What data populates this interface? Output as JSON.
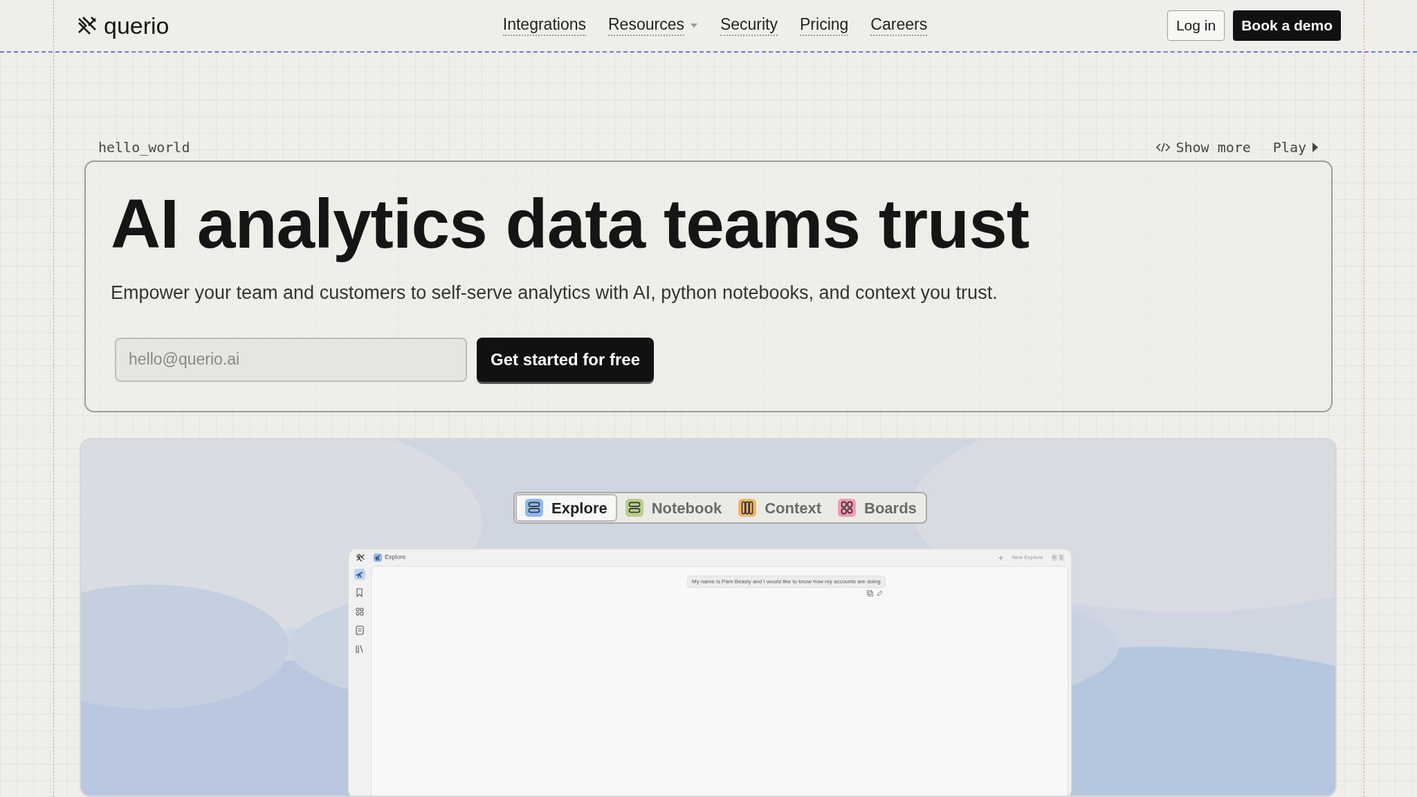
{
  "brand": {
    "name": "querio"
  },
  "nav": {
    "links": [
      {
        "label": "Integrations",
        "dropdown": false
      },
      {
        "label": "Resources",
        "dropdown": true
      },
      {
        "label": "Security",
        "dropdown": false
      },
      {
        "label": "Pricing",
        "dropdown": false
      },
      {
        "label": "Careers",
        "dropdown": false
      }
    ],
    "login": "Log in",
    "demo": "Book a demo"
  },
  "code_bar": {
    "filename": "hello_world",
    "show_more": "Show more",
    "play": "Play"
  },
  "hero": {
    "title": "AI analytics data teams trust",
    "subtitle": "Empower your team and customers to self-serve analytics with AI, python notebooks, and context you trust.",
    "email": {
      "placeholder": "hello@querio.ai"
    },
    "cta": "Get started for free"
  },
  "showcase": {
    "tabs": [
      {
        "label": "Explore",
        "selected": true,
        "color": "#8fb8ee",
        "kind": "stack"
      },
      {
        "label": "Notebook",
        "selected": false,
        "color": "#b8d08a",
        "kind": "stack"
      },
      {
        "label": "Context",
        "selected": false,
        "color": "#f2b56b",
        "kind": "columns"
      },
      {
        "label": "Boards",
        "selected": false,
        "color": "#f09ab3",
        "kind": "grid"
      }
    ],
    "app": {
      "title": "Explore",
      "new_button": "New Explore",
      "shortcut": [
        "⌘",
        "I"
      ],
      "sidebar": [
        {
          "kind": "telescope",
          "selected": true
        },
        {
          "kind": "bookmark",
          "selected": false
        },
        {
          "kind": "grid",
          "selected": false
        },
        {
          "kind": "document",
          "selected": false
        },
        {
          "kind": "books",
          "selected": false
        }
      ],
      "message": "My name is Pam Beasly and I would like to know how my accounts are doing"
    }
  }
}
